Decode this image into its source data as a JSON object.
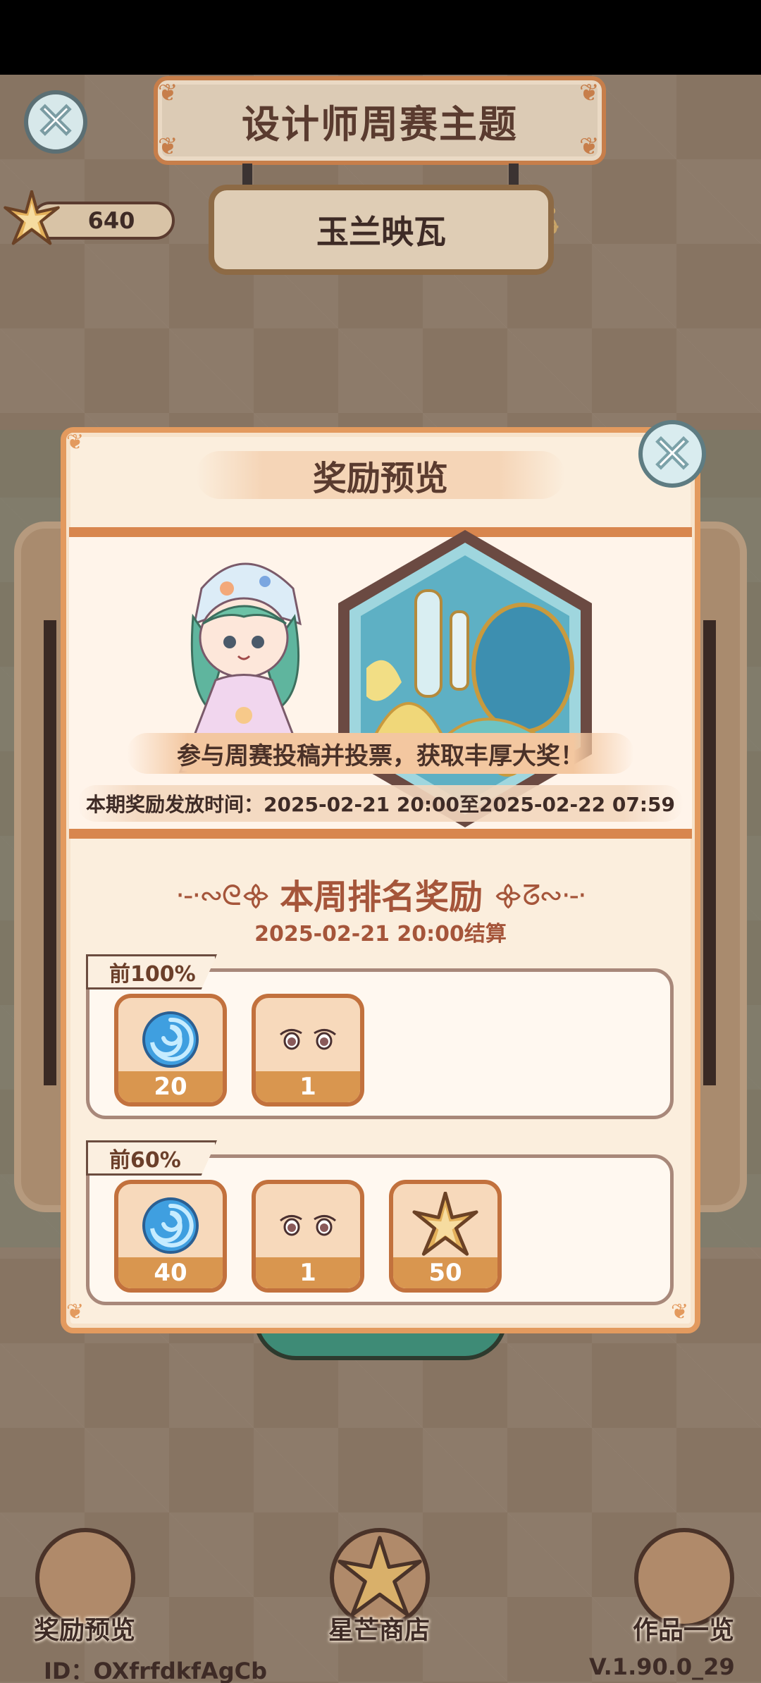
{
  "header": {
    "title": "设计师周赛主题",
    "theme_name": "玉兰映瓦",
    "star_count": "640"
  },
  "modal": {
    "title": "奖励预览",
    "banner_caption": "参与周赛投稿并投票，获取丰厚大奖！",
    "banner_time": "本期奖励发放时间：2025-02-21 20:00至2025-02-22 07:59",
    "ranking_title": "本周排名奖励",
    "settle_date": "2025-02-21 20:00结算",
    "tiers": [
      {
        "label": "前100%",
        "items": [
          {
            "icon": "blue-swirl-icon",
            "count": "20"
          },
          {
            "icon": "eyes-icon",
            "count": "1"
          }
        ]
      },
      {
        "label": "前60%",
        "items": [
          {
            "icon": "blue-swirl-icon",
            "count": "40"
          },
          {
            "icon": "eyes-icon",
            "count": "1"
          },
          {
            "icon": "star-icon",
            "count": "50"
          }
        ]
      }
    ]
  },
  "nav": {
    "rewards_label": "奖励预览",
    "shop_label": "星芒商店",
    "works_label": "作品一览"
  },
  "footer": {
    "id": "ID：OXfrfdkfAgCb",
    "version": "V.1.90.0_29"
  },
  "colors": {
    "accent_orange": "#d8864e",
    "title_brown": "#a5553a",
    "text_dark": "#3e2b26"
  }
}
